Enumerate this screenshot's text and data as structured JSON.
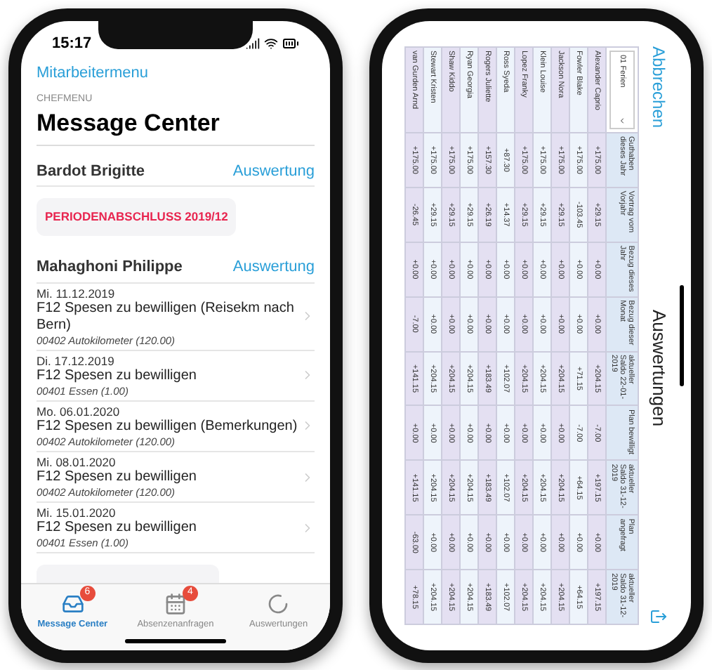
{
  "message_center": {
    "status_bar": {
      "time": "15:17"
    },
    "back_link": "Mitarbeitermenu",
    "section_label": "CHEFMENU",
    "title": "Message Center",
    "groups": [
      {
        "name": "Bardot Brigitte",
        "action": "Auswertung",
        "notices": [
          "PERIODENABSCHLUSS 2019/12"
        ]
      },
      {
        "name": "Mahaghoni Philippe",
        "action": "Auswertung",
        "items": [
          {
            "date": "Mi. 11.12.2019",
            "title": "F12 Spesen zu bewilligen (Reisekm nach Bern)",
            "detail": "00402 Autokilometer (120.00)"
          },
          {
            "date": "Di. 17.12.2019",
            "title": "F12 Spesen zu bewilligen",
            "detail": "00401 Essen (1.00)"
          },
          {
            "date": "Mo. 06.01.2020",
            "title": "F12 Spesen zu bewilligen (Bemerkungen)",
            "detail": "00402 Autokilometer (120.00)"
          },
          {
            "date": "Mi. 08.01.2020",
            "title": "F12 Spesen zu bewilligen",
            "detail": "00402 Autokilometer (120.00)"
          },
          {
            "date": "Mi. 15.01.2020",
            "title": "F12 Spesen zu bewilligen",
            "detail": "00401 Essen (1.00)"
          }
        ]
      }
    ],
    "tab_bar": [
      {
        "label": "Message Center",
        "badge": "6",
        "selected": true,
        "kind": "inbox"
      },
      {
        "label": "Absenzenanfragen",
        "badge": "4",
        "selected": false,
        "kind": "calendar"
      },
      {
        "label": "Auswertungen",
        "selected": false,
        "kind": "spinner"
      }
    ]
  },
  "auswertungen": {
    "cancel_link": "Abbrechen",
    "title": "Auswertungen",
    "table": {
      "filter": "01 Ferien",
      "columns": [
        "Guthaben dieses Jahr",
        "Vortrag vom Vorjahr",
        "Bezug dieses Jahr",
        "Bezug dieser Monat",
        "aktueller Saldo 22-01-2019",
        "Plan bewilligt",
        "aktueller Saldo 31-12-2019",
        "Plan angefragt",
        "aktueller Saldo 31-12-2019"
      ],
      "rows": [
        {
          "name": "Alexander Caprio",
          "values": [
            "+175.00",
            "+29.15",
            "+0.00",
            "+0.00",
            "+204.15",
            "-7.00",
            "+197.15",
            "+0.00",
            "+197.15"
          ]
        },
        {
          "name": "Fowler Blake",
          "values": [
            "+175.00",
            "-103.45",
            "+0.00",
            "+0.00",
            "+71.15",
            "-7.00",
            "+64.15",
            "+0.00",
            "+64.15"
          ]
        },
        {
          "name": "Jackson Nora",
          "values": [
            "+175.00",
            "+29.15",
            "+0.00",
            "+0.00",
            "+204.15",
            "+0.00",
            "+204.15",
            "+0.00",
            "+204.15"
          ]
        },
        {
          "name": "Klein Louise",
          "values": [
            "+175.00",
            "+29.15",
            "+0.00",
            "+0.00",
            "+204.15",
            "+0.00",
            "+204.15",
            "+0.00",
            "+204.15"
          ]
        },
        {
          "name": "Lopez Franky",
          "values": [
            "+175.00",
            "+29.15",
            "+0.00",
            "+0.00",
            "+204.15",
            "+0.00",
            "+204.15",
            "+0.00",
            "+204.15"
          ]
        },
        {
          "name": "Ross Syeda",
          "values": [
            "+87.30",
            "+14.37",
            "+0.00",
            "+0.00",
            "+102.07",
            "+0.00",
            "+102.07",
            "+0.00",
            "+102.07"
          ]
        },
        {
          "name": "Rogers Juliette",
          "values": [
            "+157.30",
            "+26.19",
            "+0.00",
            "+0.00",
            "+183.49",
            "+0.00",
            "+183.49",
            "+0.00",
            "+183.49"
          ]
        },
        {
          "name": "Ryan Georgia",
          "values": [
            "+175.00",
            "+29.15",
            "+0.00",
            "+0.00",
            "+204.15",
            "+0.00",
            "+204.15",
            "+0.00",
            "+204.15"
          ]
        },
        {
          "name": "Shaw Kiddo",
          "values": [
            "+175.00",
            "+29.15",
            "+0.00",
            "+0.00",
            "+204.15",
            "+0.00",
            "+204.15",
            "+0.00",
            "+204.15"
          ]
        },
        {
          "name": "Stewart Kristen",
          "values": [
            "+175.00",
            "+29.15",
            "+0.00",
            "+0.00",
            "+204.15",
            "+0.00",
            "+204.15",
            "+0.00",
            "+204.15"
          ]
        },
        {
          "name": "van Gurden Arnd",
          "values": [
            "+175.00",
            "-26.45",
            "+0.00",
            "-7.00",
            "+141.15",
            "+0.00",
            "+141.15",
            "-63.00",
            "+78.15"
          ]
        }
      ]
    }
  }
}
